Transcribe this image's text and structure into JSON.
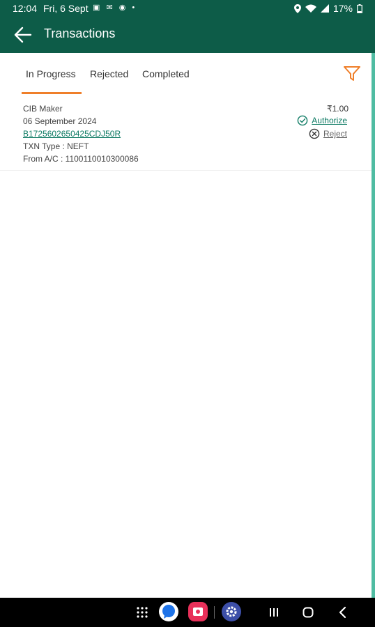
{
  "status_bar": {
    "time": "12:04",
    "date": "Fri, 6 Sept",
    "notifications": "▣ ✉ ◉ •",
    "battery": "17%"
  },
  "app_bar": {
    "title": "Transactions",
    "back_icon": "arrow-left-icon"
  },
  "tabs": [
    {
      "label": "In Progress",
      "active": true
    },
    {
      "label": "Rejected",
      "active": false
    },
    {
      "label": "Completed",
      "active": false
    }
  ],
  "filter_icon": "filter-icon",
  "transactions": [
    {
      "name": "CIB Maker",
      "date": "06 September 2024",
      "reference": "B1725602650425CDJ50R",
      "type": "TXN Type : NEFT",
      "from_account": "From A/C : 1100110010300086",
      "amount": "₹1.00",
      "authorize_label": "Authorize",
      "reject_label": "Reject"
    }
  ],
  "colors": {
    "brand": "#0d5c48",
    "accent": "#ef7f2a",
    "link": "#0d7a63"
  }
}
